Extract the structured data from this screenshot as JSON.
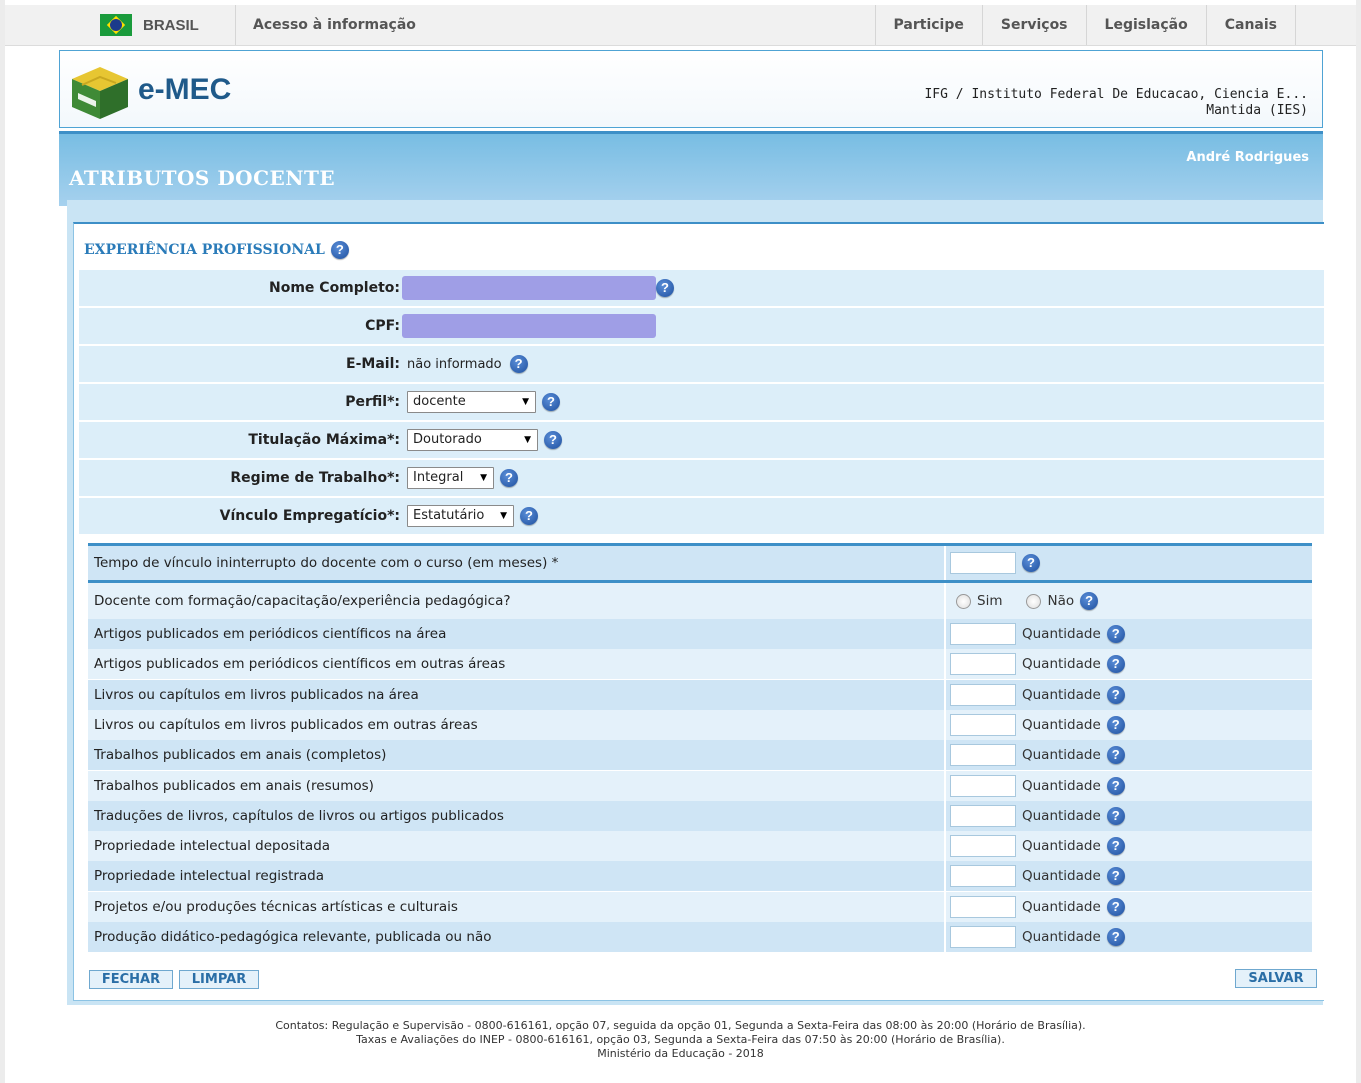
{
  "govbar": {
    "country": "BRASIL",
    "access": "Acesso à informação",
    "menu": [
      "Participe",
      "Serviços",
      "Legislação",
      "Canais"
    ]
  },
  "header": {
    "logo_text": "e-MEC",
    "ies_line1": "IFG / Instituto Federal De Educacao, Ciencia E...",
    "ies_line2": "Mantida (IES)"
  },
  "banner": {
    "title": "ATRIBUTOS DOCENTE",
    "user": "André Rodrigues"
  },
  "section": {
    "title": "EXPERIÊNCIA PROFISSIONAL"
  },
  "form": {
    "nome_label": "Nome Completo:",
    "cpf_label": "CPF:",
    "email_label": "E-Mail:",
    "email_value": "não informado",
    "perfil_label": "Perfil*:",
    "perfil_value": "docente",
    "titulacao_label": "Titulação Máxima*:",
    "titulacao_value": "Doutorado",
    "regime_label": "Regime de Trabalho*:",
    "regime_value": "Integral",
    "vinculo_label": "Vínculo Empregatício*:",
    "vinculo_value": "Estatutário"
  },
  "table": {
    "tempo_label": "Tempo de vínculo ininterrupto do docente com o curso (em meses) *",
    "pedagogica_label": "Docente com formação/capacitação/experiência pedagógica?",
    "sim": "Sim",
    "nao": "Não",
    "quantidade": "Quantidade",
    "rows": [
      "Artigos publicados em periódicos científicos na área",
      "Artigos publicados em periódicos científicos em outras áreas",
      "Livros ou capítulos em livros publicados na área",
      "Livros ou capítulos em livros publicados em outras áreas",
      "Trabalhos publicados em anais (completos)",
      "Trabalhos publicados em anais (resumos)",
      "Traduções de livros, capítulos de livros ou artigos publicados",
      "Propriedade intelectual depositada",
      "Propriedade intelectual registrada",
      "Projetos e/ou produções técnicas artísticas e culturais",
      "Produção didático-pedagógica relevante, publicada ou não"
    ]
  },
  "buttons": {
    "fechar": "FECHAR",
    "limpar": "LIMPAR",
    "salvar": "SALVAR"
  },
  "footer": {
    "line1": "Contatos: Regulação e Supervisão - 0800-616161, opção 07, seguida da opção 01, Segunda a Sexta-Feira das 08:00 às 20:00 (Horário de Brasília).",
    "line2": "Taxas e Avaliações do INEP - 0800-616161, opção 03, Segunda a Sexta-Feira das 07:50 às 20:00 (Horário de Brasília).",
    "line3": "Ministério da Educação - 2018"
  },
  "colors": {
    "accent": "#3d8fc7",
    "banner": "#78bde3",
    "row_alt": "#cfe5f5",
    "row_light": "#e4f1fa",
    "redacted": "#9f9ee6"
  },
  "icons": [
    "flag-brazil-icon",
    "emec-logo-icon",
    "help-icon",
    "dropdown-arrow-icon",
    "radio-icon"
  ]
}
